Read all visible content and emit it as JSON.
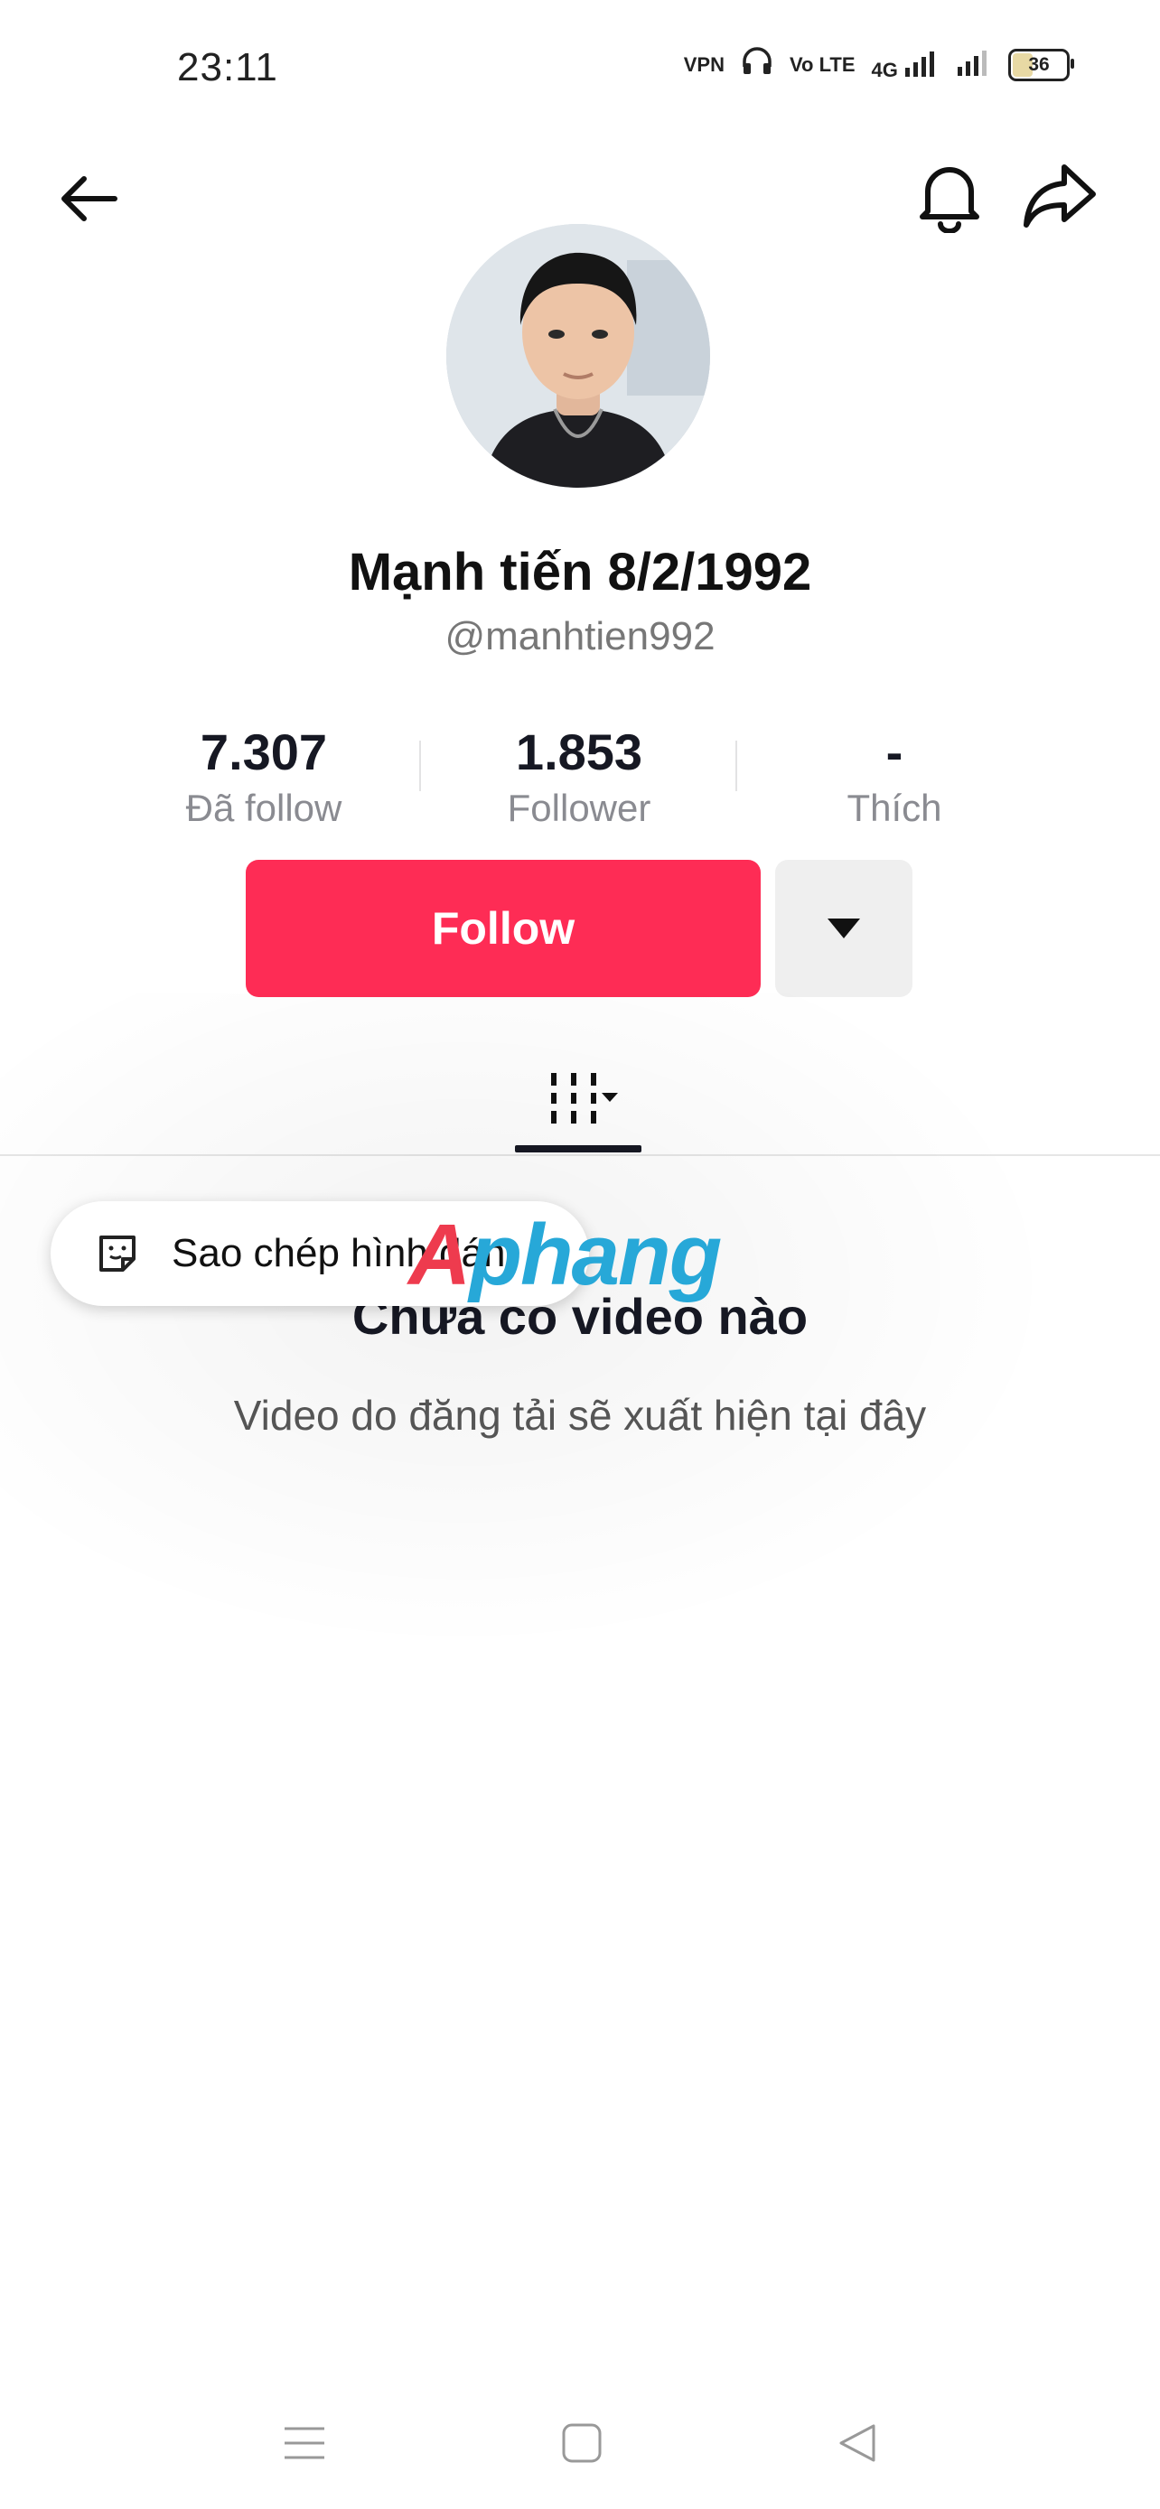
{
  "status_bar": {
    "time": "23:11",
    "icons": [
      "vpn-icon",
      "headset-icon",
      "volte-icon",
      "4g-signal-icon",
      "signal-icon"
    ],
    "vpn_label": "VPN",
    "volte_label": "Vo LTE",
    "network_label": "4G",
    "battery": "36"
  },
  "header": {
    "back_icon": "arrow-left-icon",
    "bell_icon": "bell-icon",
    "share_icon": "share-icon"
  },
  "profile": {
    "display_name": "Mạnh tiến 8/2/1992",
    "username": "@manhtien992"
  },
  "stats": [
    {
      "value": "7.307",
      "label": "Đã follow"
    },
    {
      "value": "1.853",
      "label": "Follower"
    },
    {
      "value": "-",
      "label": "Thích"
    }
  ],
  "actions": {
    "follow_label": "Follow",
    "more_icon": "caret-down-icon"
  },
  "tabs": {
    "videos_icon": "grid-videos-icon"
  },
  "empty_state": {
    "title": "Chưa có video nào",
    "subtitle": "Video do  đăng tải sẽ xuất hiện tại đây"
  },
  "toast": {
    "icon": "sticker-icon",
    "label": "Sao chép hình dán"
  },
  "watermark": {
    "part1": "A",
    "part2": "phang"
  },
  "colors": {
    "accent": "#fe2c55",
    "text": "#161823",
    "muted": "#8a8b91"
  }
}
